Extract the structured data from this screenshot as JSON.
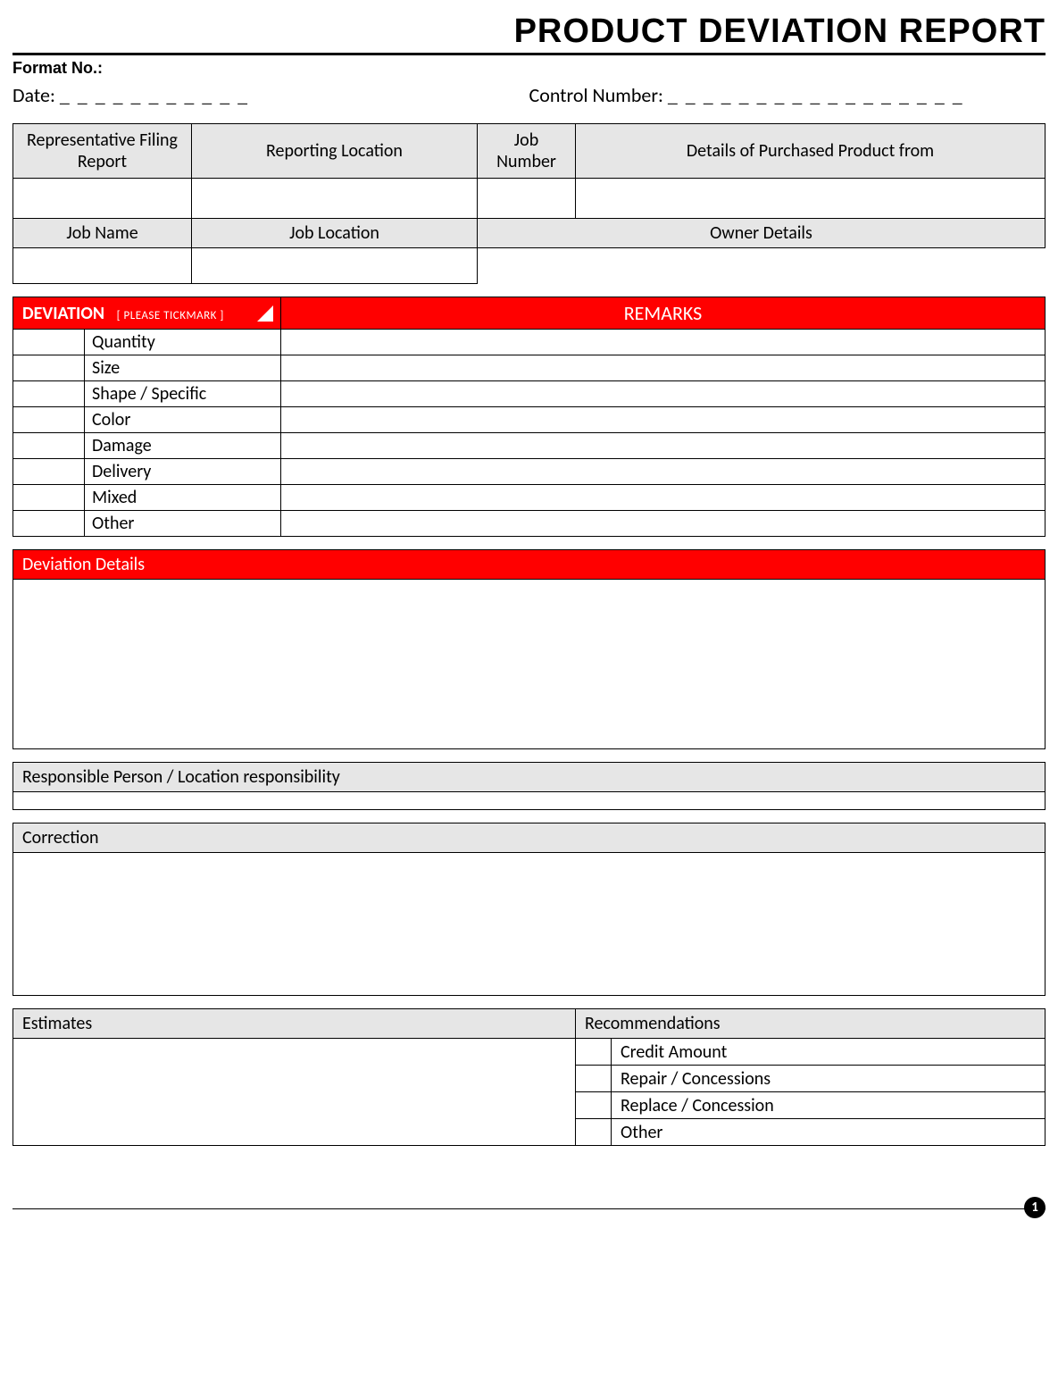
{
  "title": "PRODUCT DEVIATION REPORT",
  "format_label": "Format No.:",
  "meta": {
    "date_label": "Date:",
    "date_blank": "_ _ _ _ _ _ _ _ _ _ _",
    "control_label": "Control Number:",
    "control_blank": "_ _ _ _ _ _ _ _ _ _ _ _ _ _ _ _ _"
  },
  "info1": {
    "rep_filing": "Representative Filing Report",
    "reporting_location": "Reporting Location",
    "job_number": "Job Number",
    "purchased_from": "Details of Purchased Product from"
  },
  "info2": {
    "job_name": "Job Name",
    "job_location": "Job Location",
    "owner_details": "Owner Details"
  },
  "deviation": {
    "header": "DEVIATION",
    "tickmark": "[ PLEASE TICKMARK ]",
    "remarks": "REMARKS",
    "items": [
      "Quantity",
      "Size",
      "Shape / Specific",
      "Color",
      "Damage",
      "Delivery",
      "Mixed",
      "Other"
    ]
  },
  "sections": {
    "details": "Deviation Details",
    "responsible": "Responsible Person / Location responsibility",
    "correction": "Correction",
    "estimates": "Estimates",
    "recommendations": "Recommendations"
  },
  "recommendations": [
    "Credit Amount",
    "Repair / Concessions",
    "Replace / Concession",
    "Other"
  ],
  "page": "1"
}
